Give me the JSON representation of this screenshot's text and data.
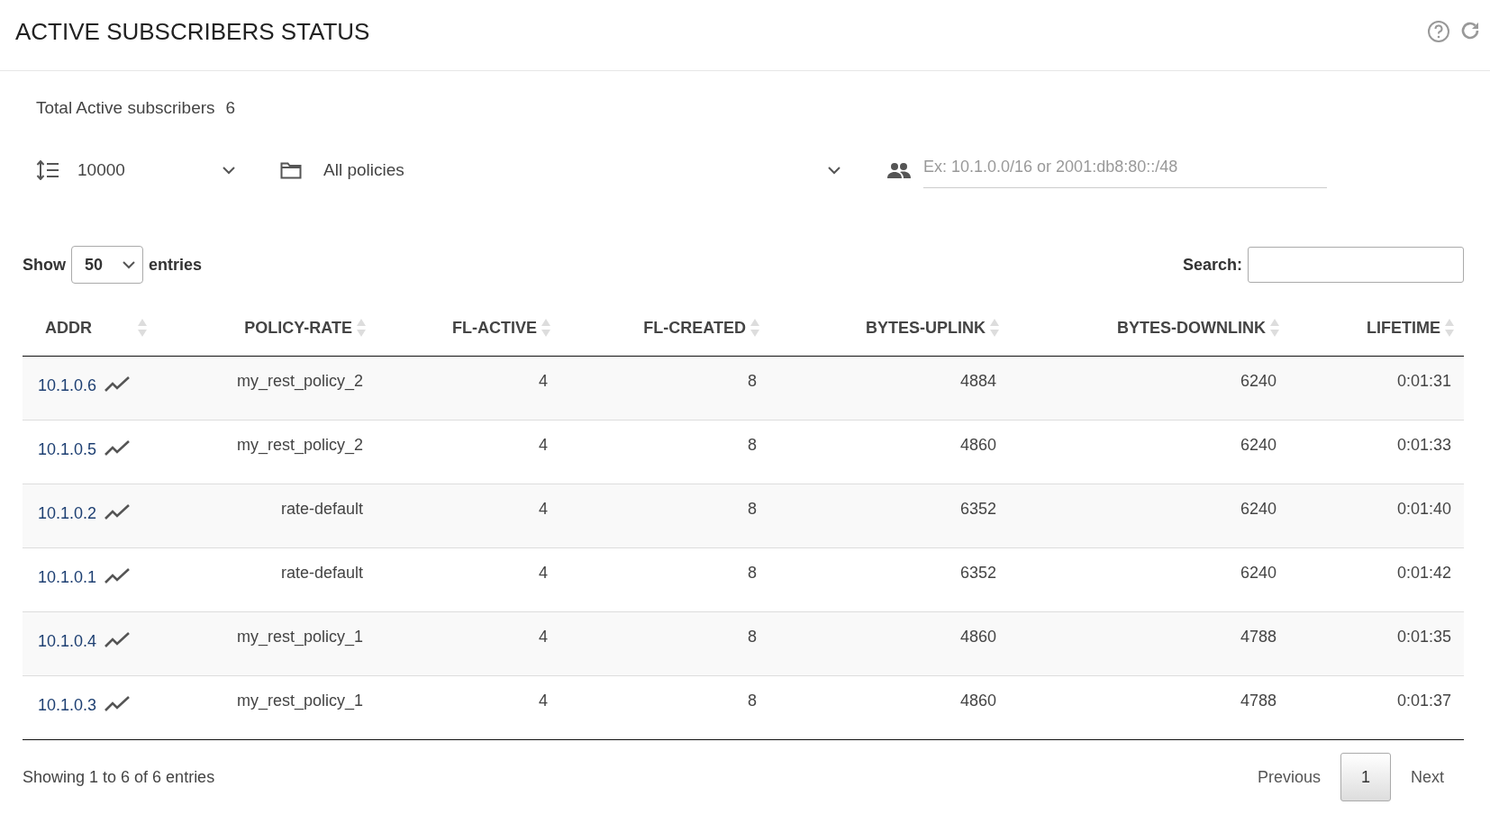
{
  "header": {
    "title": "ACTIVE SUBSCRIBERS STATUS"
  },
  "summary": {
    "label": "Total Active subscribers",
    "count": "6"
  },
  "filters": {
    "limit": "10000",
    "policy": "All policies",
    "subnet_placeholder": "Ex: 10.1.0.0/16 or 2001:db8:80::/48"
  },
  "length_control": {
    "before": "Show",
    "value": "50",
    "after": "entries"
  },
  "search": {
    "label": "Search:"
  },
  "table": {
    "columns": [
      "ADDR",
      "POLICY-RATE",
      "FL-ACTIVE",
      "FL-CREATED",
      "BYTES-UPLINK",
      "BYTES-DOWNLINK",
      "LIFETIME"
    ],
    "rows": [
      [
        "10.1.0.6",
        "my_rest_policy_2",
        "4",
        "8",
        "4884",
        "6240",
        "0:01:31"
      ],
      [
        "10.1.0.5",
        "my_rest_policy_2",
        "4",
        "8",
        "4860",
        "6240",
        "0:01:33"
      ],
      [
        "10.1.0.2",
        "rate-default",
        "4",
        "8",
        "6352",
        "6240",
        "0:01:40"
      ],
      [
        "10.1.0.1",
        "rate-default",
        "4",
        "8",
        "6352",
        "6240",
        "0:01:42"
      ],
      [
        "10.1.0.4",
        "my_rest_policy_1",
        "4",
        "8",
        "4860",
        "4788",
        "0:01:35"
      ],
      [
        "10.1.0.3",
        "my_rest_policy_1",
        "4",
        "8",
        "4860",
        "4788",
        "0:01:37"
      ]
    ]
  },
  "info": "Showing 1 to 6 of 6 entries",
  "pagination": {
    "previous": "Previous",
    "pages": [
      {
        "label": "1",
        "selected": true
      }
    ],
    "next": "Next"
  }
}
